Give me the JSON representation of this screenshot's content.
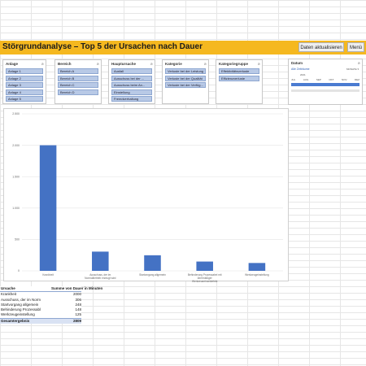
{
  "header": {
    "title": "Störgrundanalyse – Top 5 der Ursachen nach Dauer",
    "update_button": "Daten aktualisieren",
    "menu_button": "Menü"
  },
  "slicers": [
    {
      "title": "Anlage",
      "items": [
        "Anlage 1",
        "Anlage 2",
        "Anlage 3",
        "Anlage 4",
        "Anlage 5"
      ]
    },
    {
      "title": "Bereich",
      "items": [
        "Bereich A",
        "Bereich B",
        "Bereich C",
        "Bereich D"
      ]
    },
    {
      "title": "Hauptursache",
      "items": [
        "Ausfall",
        "Ausschuss bei der ...",
        "Ausschuss beim An...",
        "Einstellung",
        "Fremdverhaltung"
      ]
    },
    {
      "title": "Kategorie",
      "items": [
        "Verluste bei der Leistung",
        "Verluste bei der Qualität",
        "Verluste bei der Verfüg..."
      ]
    },
    {
      "title": "Kategoriegruppe",
      "items": [
        "Effektivitätsverluste",
        "Effizienzverluste"
      ]
    }
  ],
  "timeline": {
    "title": "Datum",
    "range_label": "Alle Zeiträume",
    "unit": "MONATE ▾",
    "year": "2021",
    "months": [
      "JUL",
      "AUG",
      "SEP",
      "OKT",
      "NOV",
      "DEZ"
    ]
  },
  "chart_data": {
    "type": "bar",
    "categories": [
      "Krankheit",
      "Ausschuss, der im Normalbetrieb erzeugt wird",
      "Startvorgang allgemein",
      "Behinderung Prozessabel mit übermäßiger Werkzeugeinzeldefekt",
      "Werkzeugeinstellung"
    ],
    "values": [
      2000,
      306,
      248,
      148,
      125
    ],
    "ylim": [
      0,
      2500
    ],
    "yticks": [
      0,
      500,
      1000,
      1500,
      2000,
      2500
    ],
    "color": "#4472c4",
    "grid": true
  },
  "pivot": {
    "col1_header": "Ursache",
    "col2_header": "Summe von Dauer in Minuten",
    "rows": [
      {
        "label": "Krankheit",
        "value": "2000"
      },
      {
        "label": "Ausschuss, der im Norm",
        "value": "306"
      },
      {
        "label": "Startvorgang allgemein",
        "value": "248"
      },
      {
        "label": "Behinderung Prozessabl",
        "value": "148"
      },
      {
        "label": "Werkzeugeinstellung",
        "value": "125"
      }
    ],
    "total_label": "Gesamtergebnis",
    "total_value": "2809"
  }
}
